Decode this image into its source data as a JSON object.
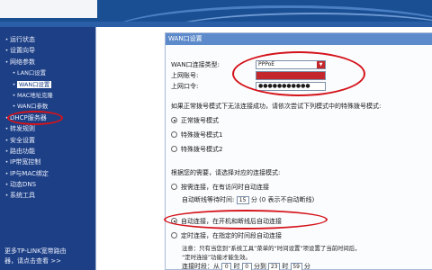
{
  "sidebar": {
    "items": [
      {
        "label": "运行状态",
        "level": "top"
      },
      {
        "label": "设置向导",
        "level": "top"
      },
      {
        "label": "网络参数",
        "level": "top"
      },
      {
        "label": "LAN口设置",
        "level": "sub"
      },
      {
        "label": "WAN口设置",
        "level": "sub",
        "active": true
      },
      {
        "label": "MAC地址克隆",
        "level": "sub"
      },
      {
        "label": "WAN口参数",
        "level": "sub"
      },
      {
        "label": "DHCP服务器",
        "level": "top"
      },
      {
        "label": "转发规则",
        "level": "top"
      },
      {
        "label": "安全设置",
        "level": "top"
      },
      {
        "label": "路由功能",
        "level": "top"
      },
      {
        "label": "IP带宽控制",
        "level": "top"
      },
      {
        "label": "IP与MAC绑定",
        "level": "top"
      },
      {
        "label": "动态DNS",
        "level": "top"
      },
      {
        "label": "系统工具",
        "level": "top"
      }
    ],
    "more_line1": "更多TP-LINK宽带路由",
    "more_line2": "器，请点击查看 >>"
  },
  "panel": {
    "title": "WAN口设置",
    "connection_type_label": "WAN口连接类型:",
    "connection_type_value": "PPPoE",
    "username_label": "上网账号:",
    "password_label": "上网口令:",
    "password_value": "●●●●●●●●●●●",
    "dial_hint": "如果正常拨号模式下无法连接成功，请依次尝试下列模式中的特殊拨号模式:",
    "dial_modes": [
      "正常拨号模式",
      "特殊拨号模式1",
      "特殊拨号模式2"
    ],
    "dial_selected": 0,
    "conn_mode_hint": "根据您的需要，请选择对应的连接模式:",
    "conn_modes": [
      {
        "label": "按需连接，在有访问时自动连接",
        "checked": false
      },
      {
        "label": "自动连接，在开机和断线后自动连接",
        "checked": true
      },
      {
        "label": "定时连接，在指定的时间段自动连接",
        "checked": false
      }
    ],
    "idle_label": "自动断线等待时间:",
    "idle_value": "15",
    "idle_suffix": "分 (0 表示不自动断线)",
    "note_line1": "注意：只有当您到“系统工具”菜单的“时间设置”项设置了当前时间后，",
    "note_line2": "“定时连接”功能才能生效。",
    "period_label": "连接时段：从",
    "period_from_h": "0",
    "period_from_m": "0",
    "period_to_h": "23",
    "period_to_m": "59",
    "hour_unit": "时",
    "min_unit": "分",
    "to_word": "分到"
  }
}
